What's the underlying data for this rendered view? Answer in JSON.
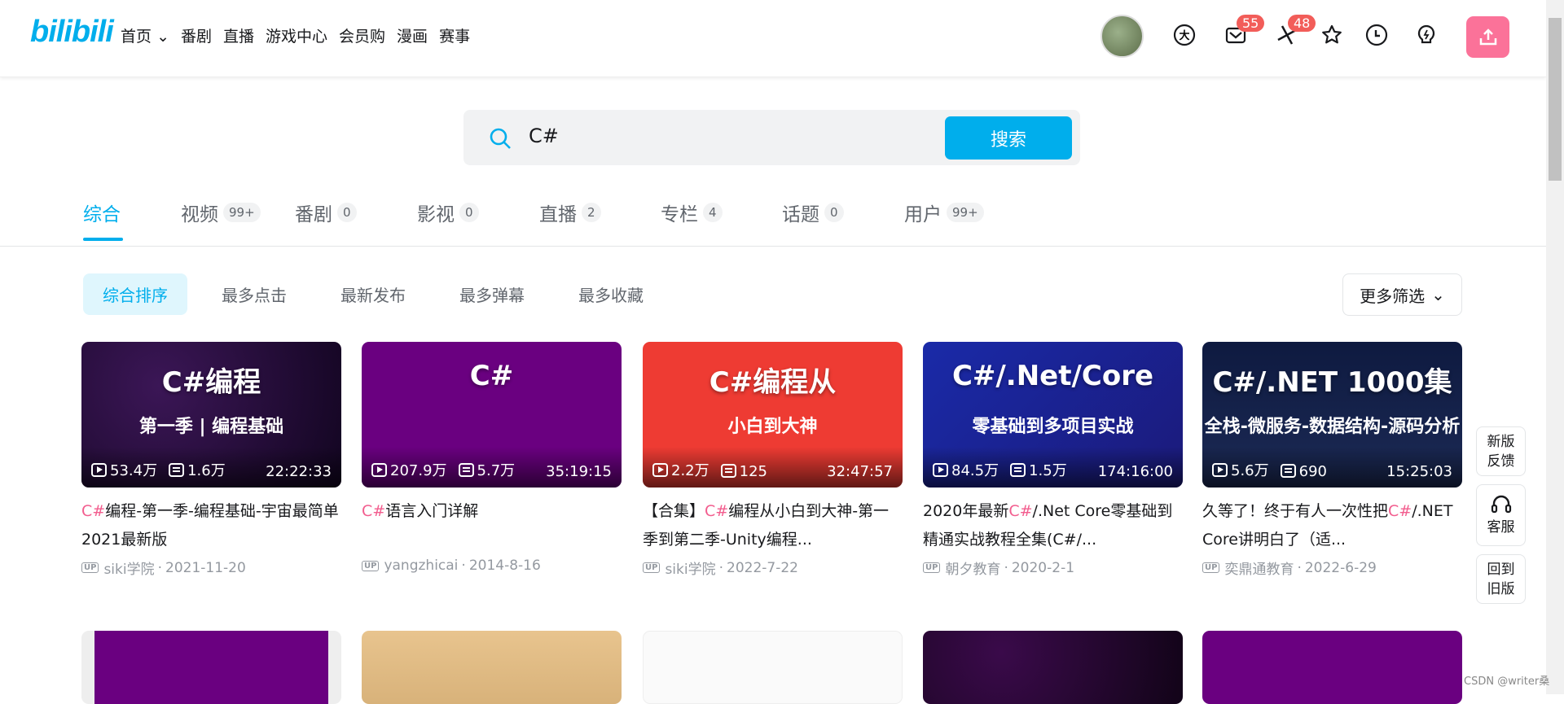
{
  "header": {
    "logo": "bilibili",
    "nav": [
      "首页",
      "番剧",
      "直播",
      "游戏中心",
      "会员购",
      "漫画",
      "赛事"
    ],
    "badges": {
      "messages": "55",
      "dynamics": "48"
    },
    "accent": "#00aeec",
    "upload_color": "#fb7299"
  },
  "search": {
    "value": "C#",
    "button": "搜索"
  },
  "tabs": [
    {
      "label": "综合",
      "count": ""
    },
    {
      "label": "视频",
      "count": "99+"
    },
    {
      "label": "番剧",
      "count": "0"
    },
    {
      "label": "影视",
      "count": "0"
    },
    {
      "label": "直播",
      "count": "2"
    },
    {
      "label": "专栏",
      "count": "4"
    },
    {
      "label": "话题",
      "count": "0"
    },
    {
      "label": "用户",
      "count": "99+"
    }
  ],
  "sorts": [
    "综合排序",
    "最多点击",
    "最新发布",
    "最多弹幕",
    "最多收藏"
  ],
  "more_filter": "更多筛选",
  "videos": [
    {
      "thumb_big": "C#编程",
      "thumb_sub": "第一季 | 编程基础",
      "plays": "53.4万",
      "danmaku": "1.6万",
      "duration": "22:22:33",
      "title_hl": "C#",
      "title": "编程-第一季-编程基础-宇宙最简单2021最新版",
      "title_pre": "",
      "author": "siki学院",
      "date": "2021-11-20"
    },
    {
      "thumb_big": "C#",
      "thumb_sub": "",
      "plays": "207.9万",
      "danmaku": "5.7万",
      "duration": "35:19:15",
      "title_hl": "C#",
      "title": "语言入门详解",
      "title_pre": "",
      "author": "yangzhicai",
      "date": "2014-8-16"
    },
    {
      "thumb_big": "C#编程从",
      "thumb_sub": "小白到大神",
      "plays": "2.2万",
      "danmaku": "125",
      "duration": "32:47:57",
      "title_hl": "C#",
      "title": "编程从小白到大神-第一季到第二季-Unity编程...",
      "title_pre": "【合集】",
      "author": "siki学院",
      "date": "2022-7-22"
    },
    {
      "thumb_big": "C#/.Net/Core",
      "thumb_sub": "零基础到多项目实战",
      "plays": "84.5万",
      "danmaku": "1.5万",
      "duration": "174:16:00",
      "title_hl": "C#",
      "title": "/.Net Core零基础到精通实战教程全集(C#/...",
      "title_pre": "2020年最新",
      "author": "朝夕教育",
      "date": "2020-2-1"
    },
    {
      "thumb_big": "C#/.NET 1000集",
      "thumb_sub": "全栈-微服务-数据结构-源码分析",
      "plays": "5.6万",
      "danmaku": "690",
      "duration": "15:25:03",
      "title_hl": "C#",
      "title": "/.NET Core讲明白了（适...",
      "title_pre": "久等了！终于有人一次性把",
      "author": "奕鼎通教育",
      "date": "2022-6-29"
    }
  ],
  "float_buttons": [
    "新版反馈",
    "客服",
    "回到旧版"
  ],
  "watermark": "CSDN @writer桑"
}
